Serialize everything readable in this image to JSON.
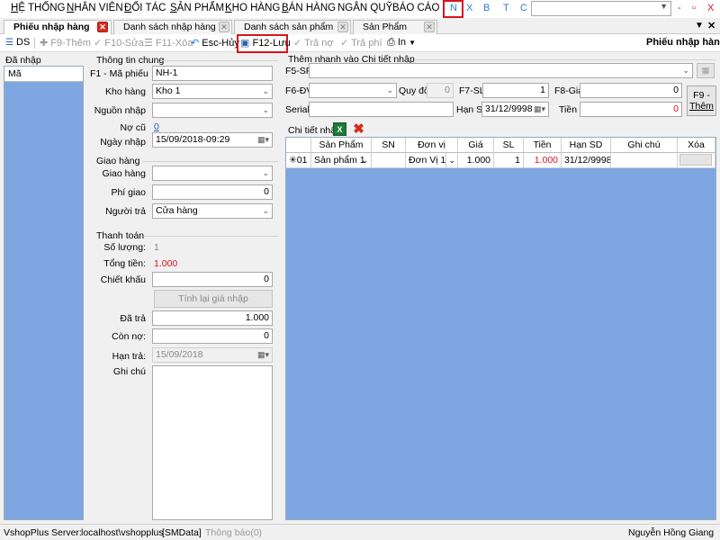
{
  "menu": {
    "items": [
      {
        "first": "H",
        "rest": "Ệ THỐNG"
      },
      {
        "first": "N",
        "rest": "HÂN VIÊN"
      },
      {
        "first": "Đ",
        "rest": "ỐI TÁC"
      },
      {
        "first": "S",
        "rest": "ẢN PHẨM"
      },
      {
        "first": "K",
        "rest": "HO HÀNG"
      },
      {
        "first": "B",
        "rest": "ÁN HÀNG"
      },
      {
        "first": "",
        "rest": "NGÂN QUỸ"
      },
      {
        "first": "",
        "rest": "BÁO CÁO"
      }
    ],
    "letters": [
      "N",
      "X",
      "B",
      "T",
      "C"
    ],
    "search_value": "",
    "window_controls": {
      "minimize": "-",
      "restore": "▫",
      "close": "X"
    }
  },
  "tabs": [
    {
      "label": "Phiếu nhập hàng"
    },
    {
      "label": "Danh sách nhập hàng"
    },
    {
      "label": "Danh sách sản phẩm"
    },
    {
      "label": "Sản Phẩm"
    }
  ],
  "tab_controls": {
    "dropdown": "▼",
    "close": "✕"
  },
  "toolbar": {
    "ds": "DS",
    "them": "F9-Thêm",
    "sua": "F10-Sửa",
    "xoa": "F11-Xóa",
    "huy": "Esc-Hủy",
    "luu": "F12-Lưu",
    "tra_no": "Trả nợ",
    "tra_phi": "Trả phí",
    "in": "In",
    "title": "Phiếu nhập hàng"
  },
  "left_panel": {
    "title": "Đã nhập",
    "item": "Mã"
  },
  "info": {
    "title": "Thông tin chung",
    "ma_phieu_label": "F1 - Mã phiếu",
    "ma_phieu_value": "NH-1",
    "kho_hang_label": "Kho hàng",
    "kho_hang_value": "Kho 1",
    "nguon_nhap_label": "Nguồn nhập",
    "nguon_nhap_value": "",
    "no_cu_label": "Nợ cũ",
    "no_cu_value": "0",
    "ngay_nhap_label": "Ngày nhập",
    "ngay_nhap_value": "15/09/2018-09:29"
  },
  "delivery": {
    "title": "Giao hàng",
    "giao_hang_label": "Giao hàng",
    "giao_hang_value": "",
    "phi_giao_label": "Phí giao",
    "phi_giao_value": "0",
    "nguoi_tra_label": "Người trả",
    "nguoi_tra_value": "Cửa hàng"
  },
  "payment": {
    "title": "Thanh toán",
    "so_luong_label": "Số lượng:",
    "so_luong_value": "1",
    "tong_tien_label": "Tổng tiền:",
    "tong_tien_value": "1.000",
    "chiet_khau_label": "Chiết khấu",
    "chiet_khau_value": "0",
    "tinh_lai_button": "Tính lại giá nhập",
    "da_tra_label": "Đã trả",
    "da_tra_value": "1.000",
    "con_no_label": "Còn nợ:",
    "con_no_value": "0",
    "han_tra_label": "Hạn trả:",
    "han_tra_value": "15/09/2018",
    "ghi_chu_label": "Ghi chú",
    "ghi_chu_value": ""
  },
  "quick_add": {
    "title": "Thêm nhanh vào Chi tiết nhập",
    "sp_label": "F5-SP",
    "sp_value": "",
    "dv_label": "F6-ĐV",
    "dv_value": "",
    "quy_doi_label": "Quy đổi",
    "quy_doi_value": "0",
    "sl_label": "F7-SL",
    "sl_value": "1",
    "gia_label": "F8-Giá",
    "gia_value": "0",
    "serial_label": "Serial",
    "serial_value": "",
    "han_sd_label": "Hạn SD",
    "han_sd_value": "31/12/9998",
    "tien_label": "Tiền",
    "tien_value": "0",
    "them_button_line1": "F9 -",
    "them_button_line2": "Thêm"
  },
  "details": {
    "title": "Chi tiết nhập",
    "columns": [
      "Sản Phẩm",
      "SN",
      "Đơn vị",
      "Giá",
      "SL",
      "Tiền",
      "Hạn SD",
      "Ghi chú",
      "Xóa"
    ],
    "row": {
      "stt": "✳01",
      "san_pham": "Sản phẩm 1",
      "sn": "",
      "don_vi": "Đơn Vị 1",
      "gia": "1.000",
      "sl": "1",
      "tien": "1.000",
      "han_sd": "31/12/9998",
      "ghi_chu": ""
    }
  },
  "status": {
    "app": "VshopPlus",
    "server_label": "Server:",
    "server_value": "localhost\\vshopplus",
    "db": "[SMData]",
    "notice": "Thông báo(0)",
    "user": "Nguyễn Hồng Giang"
  },
  "colors": {
    "accent_red": "#d8141e",
    "grid_bg": "#7ea6e0",
    "link_blue": "#1f5fbf"
  }
}
